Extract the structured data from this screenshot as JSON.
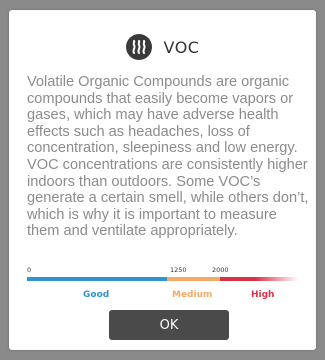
{
  "dialog": {
    "title": "VOC",
    "icon": "voc-steam-icon",
    "description": "Volatile Organic Compounds are organic compounds that easily become vapors or gases, which may have adverse health effects such as headaches, loss of concentration, sleepiness and low energy. VOC concentrations are consistently higher indoors than outdoors. Some VOC’s generate a certain smell, while others don’t, which is why it is important to measure them and ventilate appropriately.",
    "ok_label": "OK"
  },
  "scale": {
    "ticks": [
      "0",
      "1250",
      "2000"
    ],
    "levels": [
      {
        "label": "Good",
        "color": "#2e95d1"
      },
      {
        "label": "Medium",
        "color": "#f5ab68"
      },
      {
        "label": "High",
        "color": "#d8334a"
      }
    ]
  },
  "colors": {
    "button": "#4a4a4a",
    "text_muted": "#8c8c8c",
    "overlay": "#8a8a8a"
  }
}
